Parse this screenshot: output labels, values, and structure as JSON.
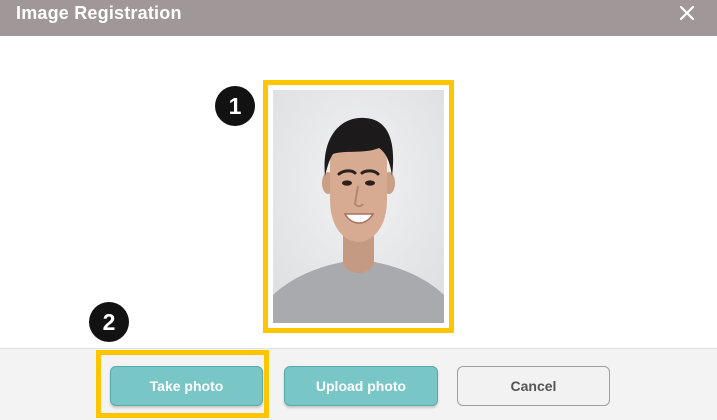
{
  "dialog": {
    "title": "Image Registration"
  },
  "markers": {
    "photo": "1",
    "take_photo": "2"
  },
  "buttons": {
    "take_photo": "Take photo",
    "upload_photo": "Upload photo",
    "cancel": "Cancel"
  },
  "colors": {
    "titlebar": "#a09898",
    "highlight": "#ffc600",
    "teal_button": "#79c6c6",
    "marker": "#121212"
  },
  "icons": {
    "close": "close-icon"
  }
}
